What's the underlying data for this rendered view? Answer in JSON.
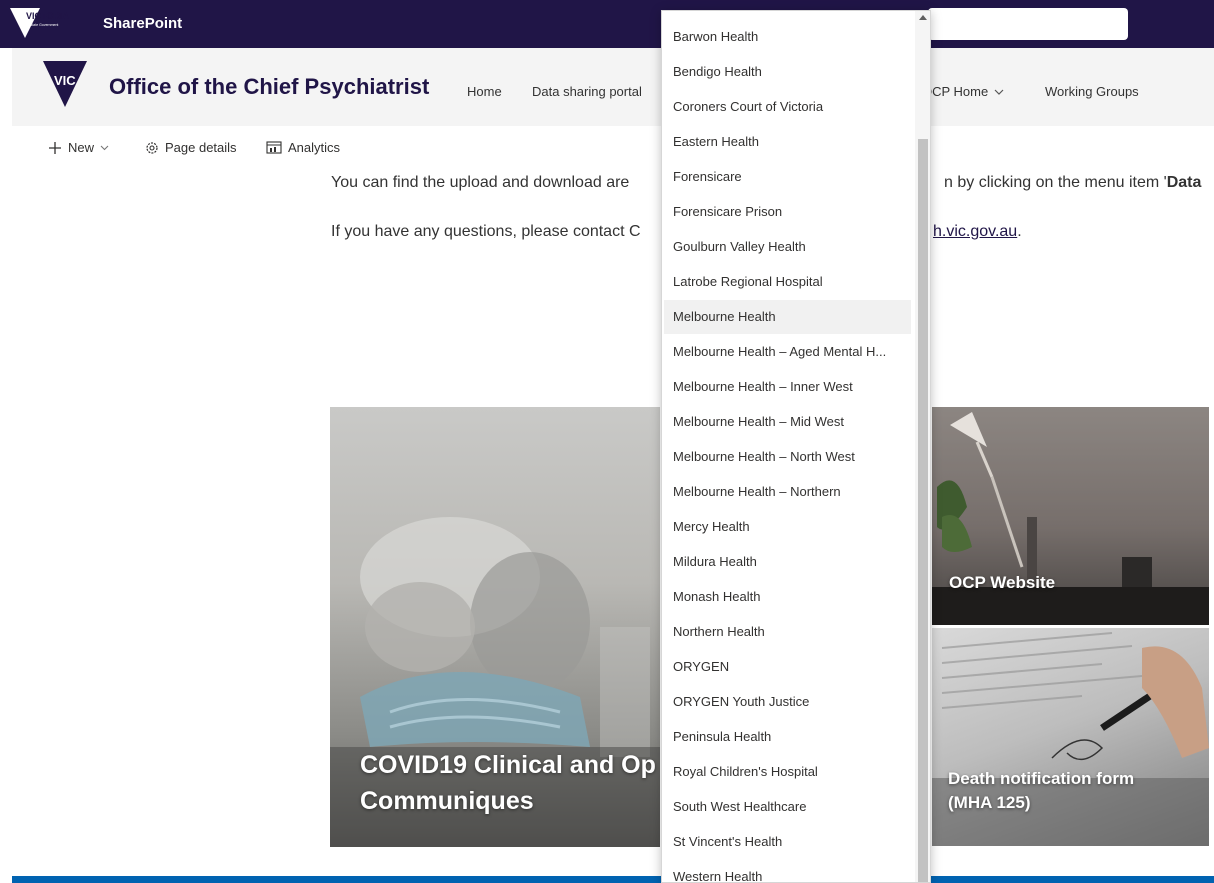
{
  "suite_bar": {
    "logo_text": "VICTORIA",
    "logo_subtext": "State Government",
    "app_name": "SharePoint"
  },
  "site_header": {
    "logo_text": "VIC",
    "title": "Office of the Chief Psychiatrist",
    "nav": [
      {
        "label": "Home"
      },
      {
        "label": "Data sharing portal"
      },
      {
        "label": "OCP Home"
      },
      {
        "label": "Working Groups"
      }
    ]
  },
  "command_bar": {
    "new_label": "New",
    "page_details_label": "Page details",
    "analytics_label": "Analytics"
  },
  "content": {
    "line1_left": "You can find the upload and download are",
    "line1_right_prefix": "n by clicking on the menu item '",
    "line1_right_bold": "Data",
    "line2_left": "If you have any questions, please contact C",
    "line2_link": "h.vic.gov.au",
    "line2_suffix": "."
  },
  "tiles": {
    "covid_line1": "COVID19 Clinical and Op",
    "covid_line2": "Communiques",
    "ocp": "OCP Website",
    "death_line1": "Death notification form",
    "death_line2": "(MHA 125)"
  },
  "dropdown": {
    "items": [
      "Barwon Health",
      "Bendigo Health",
      "Coroners Court of Victoria",
      "Eastern Health",
      "Forensicare",
      "Forensicare Prison",
      "Goulburn Valley Health",
      "Latrobe Regional Hospital",
      "Melbourne Health",
      "Melbourne Health – Aged Mental H...",
      "Melbourne Health – Inner West",
      "Melbourne Health – Mid West",
      "Melbourne Health – North West",
      "Melbourne Health – Northern",
      "Mercy Health",
      "Mildura Health",
      "Monash Health",
      "Northern Health",
      "ORYGEN",
      "ORYGEN Youth Justice",
      "Peninsula Health",
      "Royal Children's Hospital",
      "South West Healthcare",
      "St Vincent's Health",
      "Western Health"
    ],
    "highlighted": "Melbourne Health"
  },
  "colors": {
    "suite_bar": "#201547",
    "header_bg": "#f4f4f4",
    "footer_stripe": "#0063b1"
  }
}
